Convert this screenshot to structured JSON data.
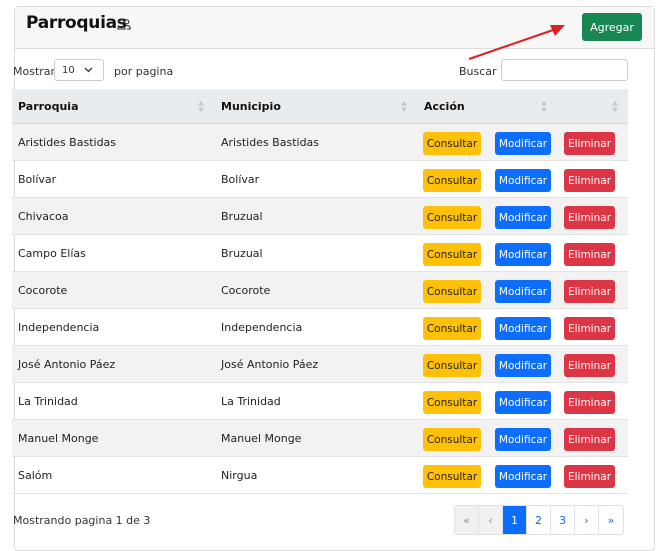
{
  "header": {
    "title": "Parroquias",
    "add_label": "Agregar",
    "title_icon": "users-icon"
  },
  "controls": {
    "show_label": "Mostrar",
    "page_size": "10",
    "per_page_label": "por pagina",
    "search_label": "Buscar",
    "search_value": ""
  },
  "table": {
    "columns": [
      "Parroquia",
      "Municipio",
      "Acción"
    ],
    "actions": {
      "consult": "Consultar",
      "modify": "Modificar",
      "delete": "Eliminar"
    },
    "rows": [
      {
        "parroquia": "Aristides Bastidas",
        "municipio": "Aristides Bastidas"
      },
      {
        "parroquia": "Bolívar",
        "municipio": "Bolívar"
      },
      {
        "parroquia": "Chivacoa",
        "municipio": "Bruzual"
      },
      {
        "parroquia": "Campo Elías",
        "municipio": "Bruzual"
      },
      {
        "parroquia": "Cocorote",
        "municipio": "Cocorote"
      },
      {
        "parroquia": "Independencia",
        "municipio": "Independencia"
      },
      {
        "parroquia": "José Antonio Páez",
        "municipio": "José Antonio Páez"
      },
      {
        "parroquia": "La Trinidad",
        "municipio": "La Trinidad"
      },
      {
        "parroquia": "Manuel Monge",
        "municipio": "Manuel Monge"
      },
      {
        "parroquia": "Salóm",
        "municipio": "Nirgua"
      }
    ]
  },
  "footer": {
    "info": "Mostrando pagina 1 de 3",
    "pagination": [
      "«",
      "‹",
      "1",
      "2",
      "3",
      "›",
      "»"
    ]
  },
  "colors": {
    "add": "#198754",
    "consult": "#ffc107",
    "modify": "#0d6efd",
    "delete": "#dc3545",
    "arrow": "#e02020"
  }
}
